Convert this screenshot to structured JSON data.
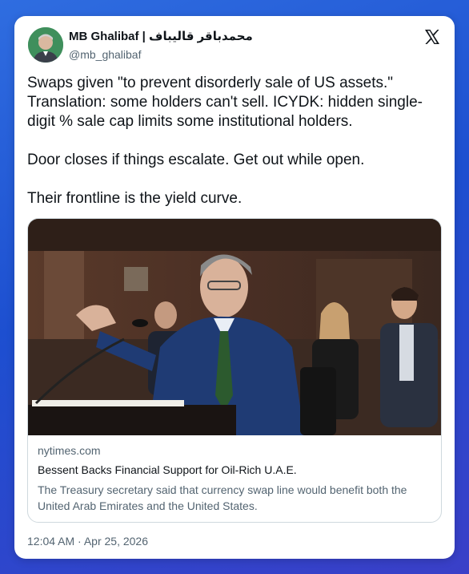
{
  "tweet": {
    "author": {
      "display_name": "MB Ghalibaf | محمدباقر قالیباف",
      "handle": "@mb_ghalibaf",
      "avatar_icon": "profile-photo"
    },
    "platform_icon": "x-logo-icon",
    "text": [
      "Swaps given \"to prevent disorderly sale of US assets.\" Translation: some holders can't sell. ICYDK: hidden single-digit % sale cap limits some institutional holders.",
      "Door closes if things escalate. Get out while open.",
      "Their frontline is the yield curve."
    ],
    "link_card": {
      "domain": "nytimes.com",
      "title": "Bessent Backs Financial Support for Oil-Rich U.A.E.",
      "description": "The Treasury secretary said that currency swap line would benefit both the United Arab Emirates and the United States."
    },
    "timestamp": "12:04 AM · Apr 25, 2026"
  }
}
